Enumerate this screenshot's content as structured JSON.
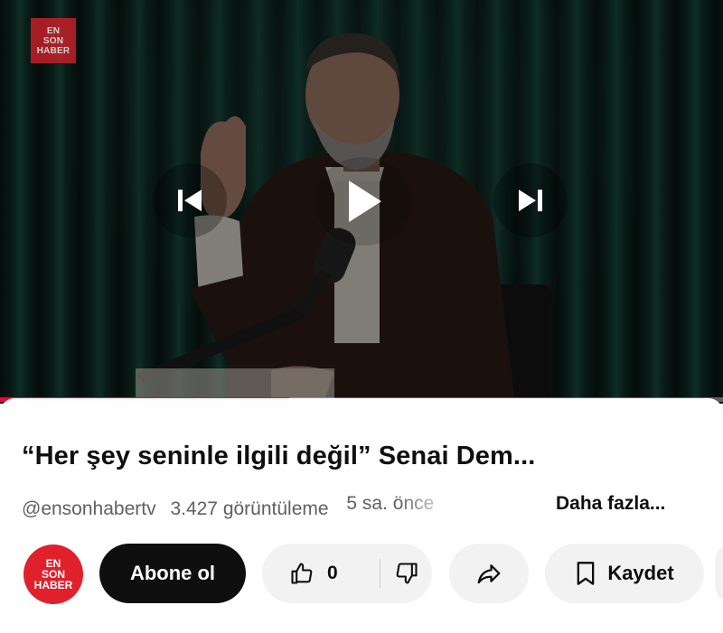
{
  "player": {
    "logo_lines": [
      "EN",
      "SON",
      "HABER"
    ],
    "progress_fraction": 0.4,
    "icons": {
      "previous": "skip-previous-icon",
      "play": "play-icon",
      "next": "skip-next-icon"
    }
  },
  "video": {
    "title": "“Her şey seninle ilgili değil” Senai Dem...",
    "channel_handle": "@ensonhabertv",
    "views": "3.427 görüntüleme",
    "time_ago": "5 sa. önce",
    "more_label": "Daha fazla..."
  },
  "channel": {
    "avatar_lines": [
      "EN",
      "SON",
      "HABER"
    ],
    "brand_color": "#e0212b"
  },
  "actions": {
    "subscribe_label": "Abone ol",
    "like_count": "0",
    "save_label": "Kaydet",
    "icons": {
      "like": "thumbs-up-icon",
      "dislike": "thumbs-down-icon",
      "share": "share-icon",
      "save": "bookmark-icon"
    }
  },
  "colors": {
    "accent": "#ff0033",
    "subscribe_bg": "#0f0f0f",
    "pill_bg": "#f2f2f2"
  }
}
